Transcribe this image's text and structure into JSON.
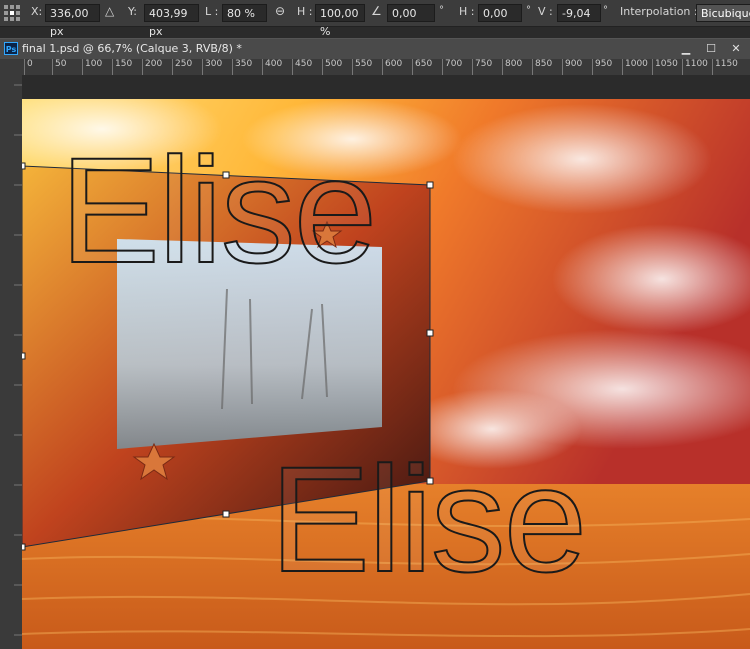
{
  "options_bar": {
    "x_label": "X:",
    "x_value": "336,00 px",
    "y_label": "Y:",
    "y_value": "403,99 px",
    "w_label": "L :",
    "w_value": "80 %",
    "h_label": "H :",
    "h_value": "100,00 %",
    "angle_value": "0,00",
    "angle_unit": "°",
    "hskew_label": "H :",
    "hskew_value": "0,00",
    "hskew_unit": "°",
    "vskew_label": "V :",
    "vskew_value": "-9,04",
    "vskew_unit": "°",
    "interpolation_label": "Interpolation :",
    "interpolation_value": "Bicubique"
  },
  "document": {
    "title": "final 1.psd @ 66,7% (Calque 3, RVB/8) *",
    "app_icon": "Ps"
  },
  "ruler": {
    "h_ticks": [
      "0",
      "50",
      "100",
      "150",
      "200",
      "250",
      "300",
      "350",
      "400",
      "450",
      "500",
      "550",
      "600",
      "650",
      "700",
      "750",
      "800",
      "850",
      "900",
      "950",
      "1000",
      "1050",
      "1100",
      "1150"
    ]
  },
  "canvas": {
    "text_top": "Elise",
    "text_bottom": "Elise"
  }
}
